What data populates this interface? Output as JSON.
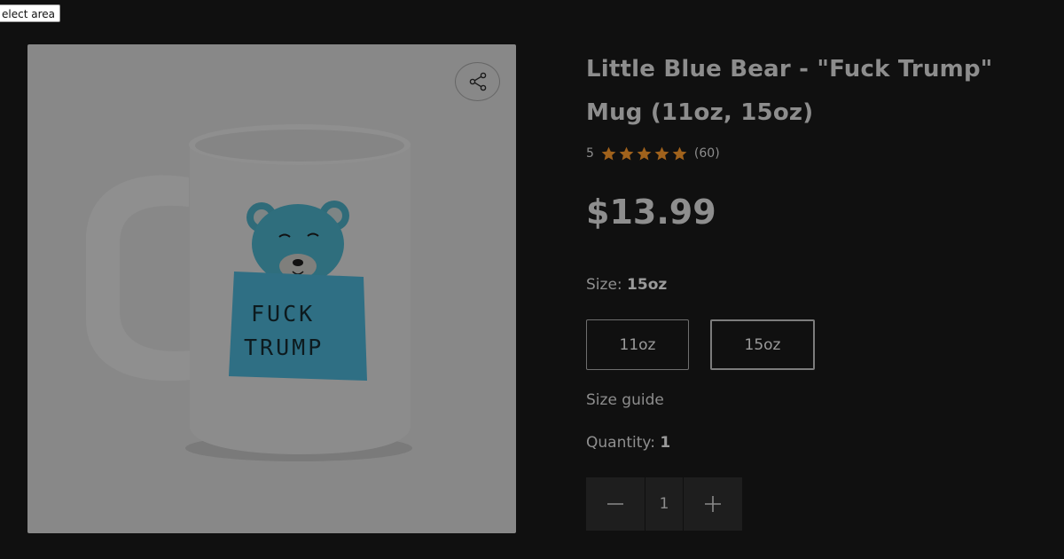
{
  "overlay": {
    "select_area_label": "elect area"
  },
  "product": {
    "title": "Little Blue Bear - \"Fuck Trump\" Mug (11oz, 15oz)",
    "rating": {
      "score": "5",
      "stars": 5,
      "count": "(60)"
    },
    "price": "$13.99",
    "mug_text_line1": "Fuck",
    "mug_text_line2": "Trump"
  },
  "size": {
    "label": "Size:",
    "selected": "15oz",
    "options": [
      "11oz",
      "15oz"
    ],
    "guide_label": "Size guide"
  },
  "quantity": {
    "label": "Quantity:",
    "value": "1"
  },
  "icons": {
    "share": "share-icon",
    "minus": "minus-icon",
    "plus": "plus-icon",
    "star": "star-icon"
  },
  "colors": {
    "background": "#101010",
    "image_bg": "#888888",
    "star": "#a0621c",
    "text": "#8d8d8d"
  }
}
